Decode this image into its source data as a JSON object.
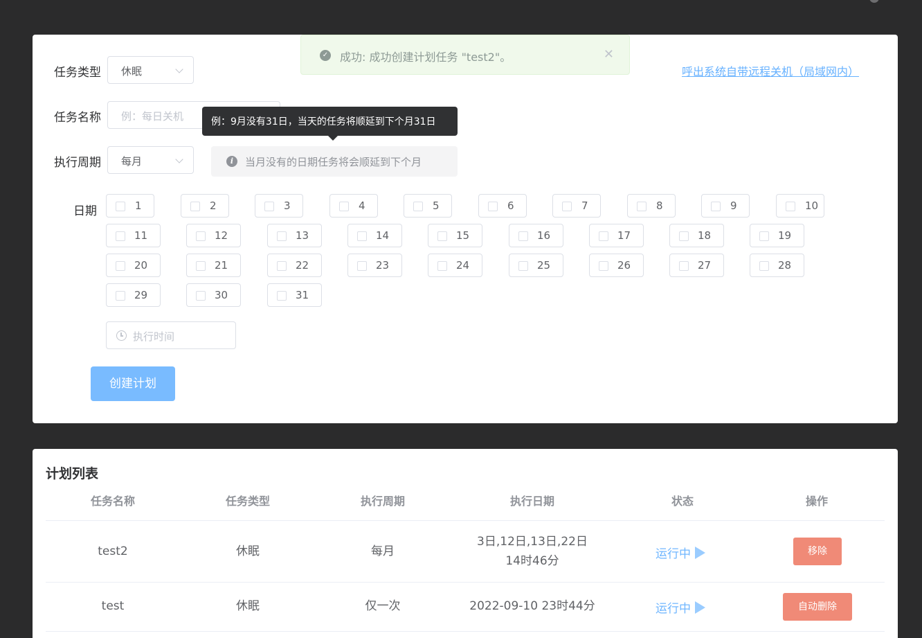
{
  "form": {
    "task_type_label": "任务类型",
    "task_type_value": "休眠",
    "task_name_label": "任务名称",
    "task_name_placeholder": "例：每日关机",
    "period_label": "执行周期",
    "period_value": "每月",
    "date_label": "日期",
    "dates": [
      "1",
      "2",
      "3",
      "4",
      "5",
      "6",
      "7",
      "8",
      "9",
      "10",
      "11",
      "12",
      "13",
      "14",
      "15",
      "16",
      "17",
      "18",
      "19",
      "20",
      "21",
      "22",
      "23",
      "24",
      "25",
      "26",
      "27",
      "28",
      "29",
      "30",
      "31"
    ],
    "time_placeholder": "执行时间",
    "create_button": "创建计划",
    "remote_link": "呼出系统自带远程关机（局域网内）",
    "hint_text": "当月没有的日期任务将会顺延到下个月",
    "tooltip_text": "例：9月没有31日，当天的任务将顺延到下个月31日"
  },
  "message": {
    "text": "成功: 成功创建计划任务 \"test2\"。",
    "close_icon": "close-icon",
    "status_icon": "check-circle-icon"
  },
  "list": {
    "title": "计划列表",
    "headers": [
      "任务名称",
      "任务类型",
      "执行周期",
      "执行日期",
      "状态",
      "操作"
    ],
    "rows": [
      {
        "name": "test2",
        "type": "休眠",
        "period": "每月",
        "date_line1": "3日,12日,13日,22日",
        "date_line2": "14时46分",
        "status": "运行中",
        "action": "移除"
      },
      {
        "name": "test",
        "type": "休眠",
        "period": "仅一次",
        "date_line1": "2022-09-10 23时44分",
        "date_line2": "",
        "status": "运行中",
        "action": "自动删除"
      }
    ]
  },
  "colors": {
    "primary_light": "#79bbff",
    "danger_light": "#f08a77",
    "success_bg": "#f0f9eb",
    "dark_bg": "#2b2b2c"
  }
}
